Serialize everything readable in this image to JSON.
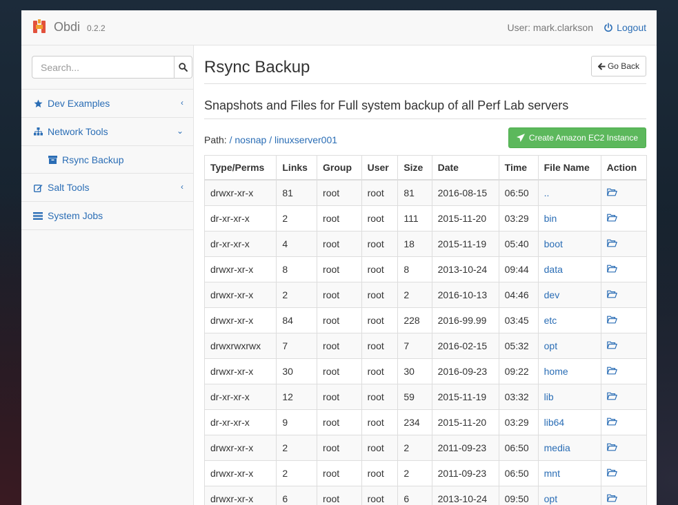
{
  "app": {
    "name": "Obdi",
    "version": "0.2.2",
    "user": "User: mark.clarkson",
    "logout": "Logout"
  },
  "colors": {
    "link": "#2a6db5",
    "success": "#5cb85c",
    "logo_red": "#e2513c",
    "logo_orange": "#f0a030"
  },
  "sidebar": {
    "search_placeholder": "Search...",
    "items": [
      {
        "label": "Dev Examples",
        "icon": "star-icon",
        "chevron": "‹"
      },
      {
        "label": "Network Tools",
        "icon": "sitemap-icon",
        "chevron": "⌄"
      },
      {
        "label": "Rsync Backup",
        "icon": "archive-icon"
      },
      {
        "label": "Salt Tools",
        "icon": "edit-icon",
        "chevron": "‹"
      },
      {
        "label": "System Jobs",
        "icon": "list-icon"
      }
    ]
  },
  "main": {
    "title": "Rsync Backup",
    "go_back": "Go Back",
    "subtitle": "Snapshots and Files for Full system backup of all Perf Lab servers",
    "path_label": "Path:",
    "path": [
      "nosnap",
      "linuxserver001"
    ],
    "ec2_button": "Create Amazon EC2 Instance",
    "columns": [
      "Type/Perms",
      "Links",
      "Group",
      "User",
      "Size",
      "Date",
      "Time",
      "File Name",
      "Action"
    ],
    "rows": [
      [
        "drwxr-xr-x",
        "81",
        "root",
        "root",
        "81",
        "2016-08-15",
        "06:50",
        ".."
      ],
      [
        "dr-xr-xr-x",
        "2",
        "root",
        "root",
        "111",
        "2015-11-20",
        "03:29",
        "bin"
      ],
      [
        "dr-xr-xr-x",
        "4",
        "root",
        "root",
        "18",
        "2015-11-19",
        "05:40",
        "boot"
      ],
      [
        "drwxr-xr-x",
        "8",
        "root",
        "root",
        "8",
        "2013-10-24",
        "09:44",
        "data"
      ],
      [
        "drwxr-xr-x",
        "2",
        "root",
        "root",
        "2",
        "2016-10-13",
        "04:46",
        "dev"
      ],
      [
        "drwxr-xr-x",
        "84",
        "root",
        "root",
        "228",
        "2016-99.99",
        "03:45",
        "etc"
      ],
      [
        "drwxrwxrwx",
        "7",
        "root",
        "root",
        "7",
        "2016-02-15",
        "05:32",
        "opt"
      ],
      [
        "drwxr-xr-x",
        "30",
        "root",
        "root",
        "30",
        "2016-09-23",
        "09:22",
        "home"
      ],
      [
        "dr-xr-xr-x",
        "12",
        "root",
        "root",
        "59",
        "2015-11-19",
        "03:32",
        "lib"
      ],
      [
        "dr-xr-xr-x",
        "9",
        "root",
        "root",
        "234",
        "2015-11-20",
        "03:29",
        "lib64"
      ],
      [
        "drwxr-xr-x",
        "2",
        "root",
        "root",
        "2",
        "2011-09-23",
        "06:50",
        "media"
      ],
      [
        "drwxr-xr-x",
        "2",
        "root",
        "root",
        "2",
        "2011-09-23",
        "06:50",
        "mnt"
      ],
      [
        "drwxr-xr-x",
        "6",
        "root",
        "root",
        "6",
        "2013-10-24",
        "09:50",
        "opt"
      ]
    ]
  }
}
